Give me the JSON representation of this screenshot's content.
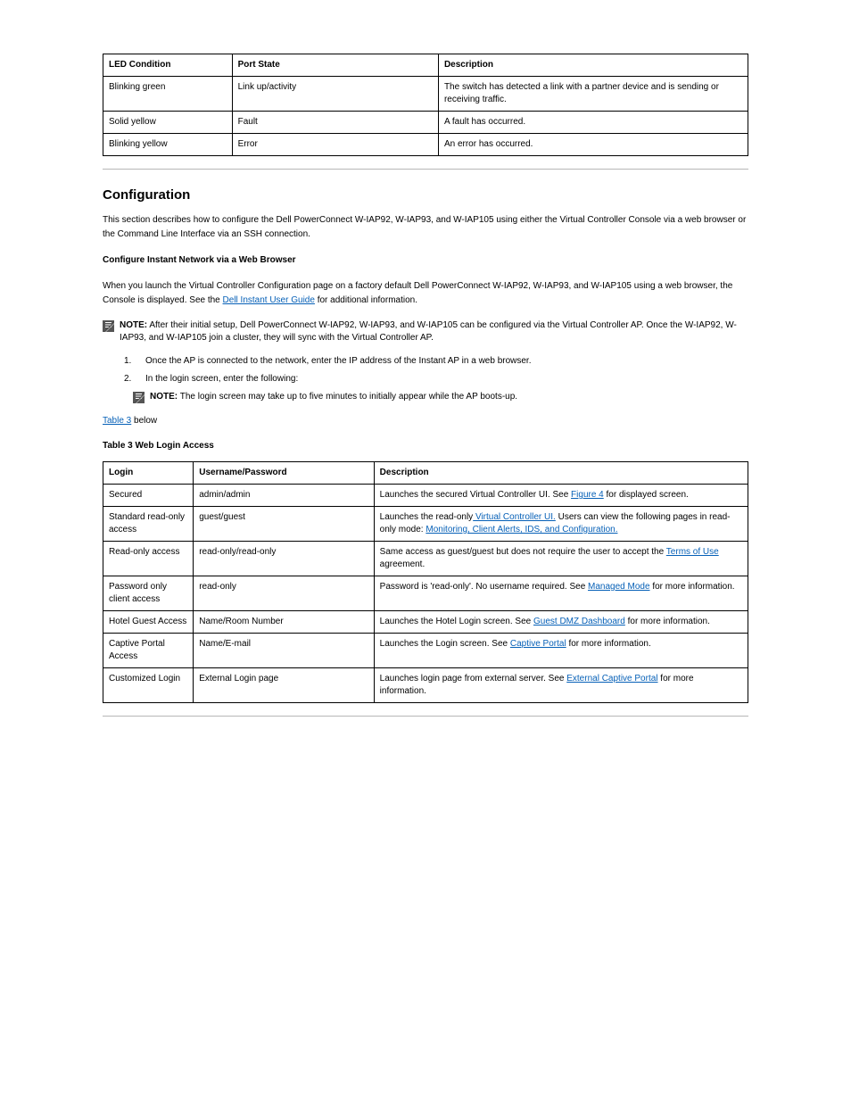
{
  "table2": {
    "headers": {
      "c0": "LED Condition",
      "c1": "Port State",
      "c2": "Description"
    },
    "rows": [
      {
        "c0": "Blinking green",
        "c1": "Link up/activity",
        "c2": "The switch has detected a link with a partner device and is sending or receiving traffic."
      },
      {
        "c0": "Solid yellow",
        "c1": "Fault",
        "c2": "A fault has occurred."
      },
      {
        "c0": "Blinking yellow",
        "c1": "Error",
        "c2": "An error has occurred."
      }
    ]
  },
  "section": {
    "h_config": "Configuration",
    "p_intro": "This section describes how to configure the Dell PowerConnect W-IAP92, W-IAP93, and W-IAP105 using either the Virtual Controller Console via a web browser or the Command Line Interface via an SSH connection.",
    "h_web": "Configure Instant Network via a Web Browser",
    "p_web": "When you launch the Virtual Controller Configuration page on a factory default Dell PowerConnect W-IAP92, W-IAP93, and W-IAP105 using a web browser, the Console is displayed. See the ",
    "p_web_link": "Dell Instant User Guide",
    "p_web_after": " for additional information.",
    "note1": "NOTE: After their initial setup, Dell PowerConnect W-IAP92, W-IAP93, and W-IAP105 can be configured via the Virtual Controller AP. Once the W-IAP92, W-IAP93, and W-IAP105 join a cluster, they will sync with the Virtual Controller AP.",
    "step1": {
      "num": "1.",
      "text": "Once the AP is connected to the network, enter the IP address of the Instant AP in a web browser."
    },
    "step2": {
      "num": "2.",
      "text": "In the login screen, enter the following:"
    },
    "note2": "NOTE: The login screen may take up to five minutes to initially appear while the AP boots-up.",
    "table3_intro_pre": "",
    "table3_intro_link": "Table 3",
    "table3_intro_after": " below"
  },
  "table3": {
    "title": "Table 3  Web Login Access",
    "headers": {
      "c0": "Login",
      "c1": "Username/Password",
      "c2": "Description"
    },
    "rows": [
      {
        "c0": "Secured",
        "c1": "admin/admin",
        "c2_pre": "Launches the secured Virtual Controller UI. See",
        "c2_link": "Figure 4",
        "c2_after": "for displayed screen."
      },
      {
        "c0": "Standard read-only access",
        "c1": "guest/guest",
        "c2_pre": "Launches the read-only",
        "c2_link": " Virtual Controller UI.",
        "c2_after": "Users can view the following pages in read-only mode: ",
        "c2_link2": "Monitoring, Client Alerts, IDS, and Configuration."
      },
      {
        "c0": "Read-only access",
        "c1": "read-only/read-only",
        "c2_pre": "Same access as guest/guest but does not require the user to accept the",
        "c2_link": "Terms of Use",
        "c2_after": "agreement."
      },
      {
        "c0": "Password only client access",
        "c1": "read-only",
        "c2_pre": "Password is 'read-only'. No username required. See ",
        "c2_link": "Managed Mode",
        "c2_after": "for more information."
      },
      {
        "c0": "Hotel Guest Access",
        "c1": "Name/Room Number",
        "c2_pre": "Launches the Hotel Login screen. See ",
        "c2_link": "Guest DMZ Dashboard",
        "c2_after": "for more information."
      },
      {
        "c0": "Captive Portal Access",
        "c1": "Name/E-mail",
        "c2_pre": "Launches the Login screen. See ",
        "c2_link": "Captive Portal",
        "c2_after": "for more information."
      },
      {
        "c0": "Customized Login",
        "c1": "External Login page",
        "c2_pre": "Launches login page from external server. See ",
        "c2_link": "External Captive Portal",
        "c2_after": "for more information."
      }
    ]
  }
}
